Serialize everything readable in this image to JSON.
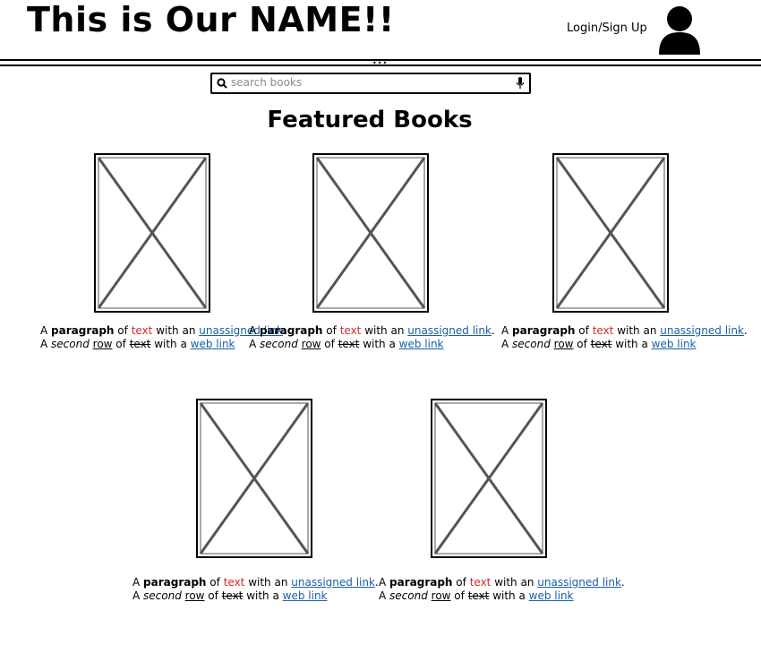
{
  "header": {
    "site_title": "This is Our NAME!!",
    "login_label": "Login/Sign Up",
    "avatar_icon": "user-avatar-icon"
  },
  "search": {
    "placeholder": "search books",
    "search_icon": "search-icon",
    "mic_icon": "microphone-icon"
  },
  "featured": {
    "title": "Featured Books",
    "books": [
      {
        "image_icon": "image-placeholder-icon",
        "line1": {
          "prefix": "A ",
          "bold": "paragraph",
          "mid1": " of ",
          "colored": "text",
          "mid2": " with an ",
          "link": "unassigned link",
          "suffix": "."
        },
        "line2": {
          "prefix": "A ",
          "italic": "second",
          "gap1": " ",
          "underlined": "row",
          "mid1": " of ",
          "strike": "text",
          "mid2": " with a ",
          "link": "web link"
        }
      },
      {
        "image_icon": "image-placeholder-icon",
        "line1": {
          "prefix": "A ",
          "bold": "paragraph",
          "mid1": " of ",
          "colored": "text",
          "mid2": " with an ",
          "link": "unassigned link",
          "suffix": "."
        },
        "line2": {
          "prefix": "A ",
          "italic": "second",
          "gap1": " ",
          "underlined": "row",
          "mid1": " of ",
          "strike": "text",
          "mid2": " with a ",
          "link": "web link"
        }
      },
      {
        "image_icon": "image-placeholder-icon",
        "line1": {
          "prefix": "A ",
          "bold": "paragraph",
          "mid1": " of ",
          "colored": "text",
          "mid2": " with an ",
          "link": "unassigned link",
          "suffix": "."
        },
        "line2": {
          "prefix": "A ",
          "italic": "second",
          "gap1": " ",
          "underlined": "row",
          "mid1": " of ",
          "strike": "text",
          "mid2": " with a ",
          "link": "web link"
        }
      },
      {
        "image_icon": "image-placeholder-icon",
        "line1": {
          "prefix": "A ",
          "bold": "paragraph",
          "mid1": " of ",
          "colored": "text",
          "mid2": " with an ",
          "link": "unassigned link",
          "suffix": "."
        },
        "line2": {
          "prefix": "A ",
          "italic": "second",
          "gap1": " ",
          "underlined": "row",
          "mid1": " of ",
          "strike": "text",
          "mid2": " with a ",
          "link": "web link"
        }
      },
      {
        "image_icon": "image-placeholder-icon",
        "line1": {
          "prefix": "A ",
          "bold": "paragraph",
          "mid1": " of ",
          "colored": "text",
          "mid2": " with an ",
          "link": "unassigned link",
          "suffix": "."
        },
        "line2": {
          "prefix": "A ",
          "italic": "second",
          "gap1": " ",
          "underlined": "row",
          "mid1": " of ",
          "strike": "text",
          "mid2": " with a ",
          "link": "web link"
        }
      }
    ]
  },
  "colors": {
    "highlight_text": "#d62a2a",
    "link": "#1a5ea6"
  }
}
